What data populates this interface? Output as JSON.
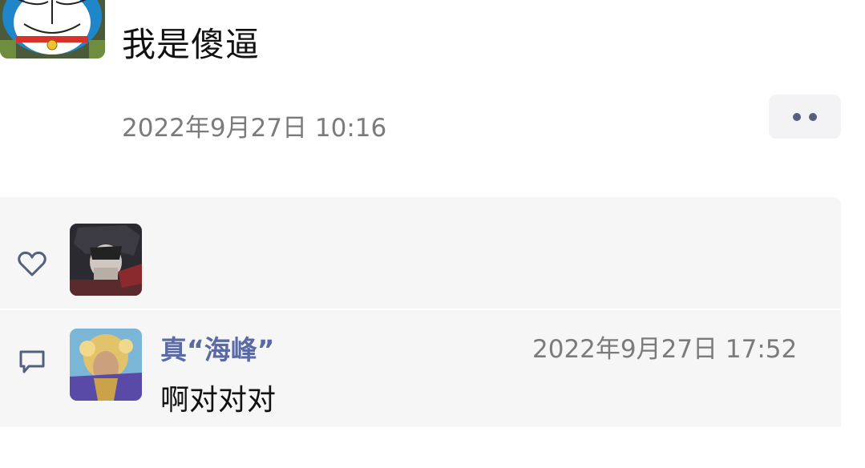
{
  "post": {
    "text": "我是傻逼",
    "timestamp": "2022年9月27日 10:16",
    "more_button_icon": "more-dots-icon"
  },
  "likes": {
    "icon": "heart-icon"
  },
  "comments": {
    "icon": "comment-icon",
    "items": [
      {
        "name": "真“海峰”",
        "time": "2022年9月27日 17:52",
        "text": "啊对对对"
      }
    ]
  },
  "colors": {
    "name_blue": "#5b6aa3",
    "panel_bg": "#f6f6f6",
    "muted_text": "#7b7b7b"
  }
}
